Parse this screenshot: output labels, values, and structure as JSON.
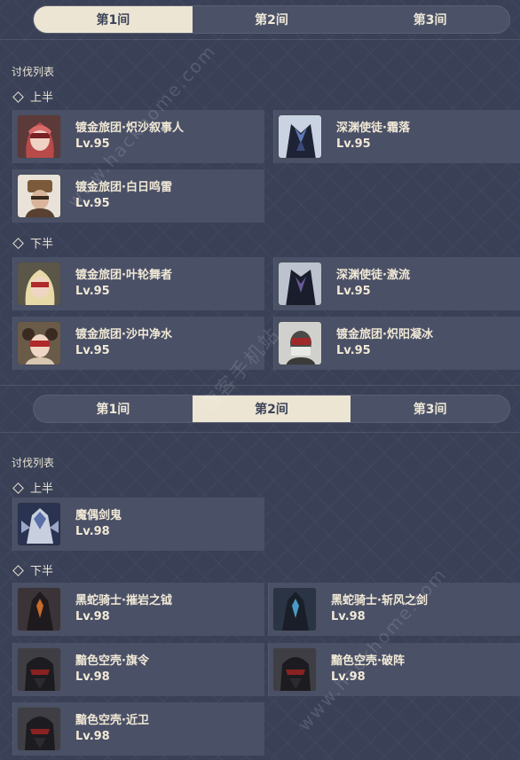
{
  "section1": {
    "tabs": [
      "第1间",
      "第2间",
      "第3间"
    ],
    "active_tab": 0,
    "list_title": "讨伐列表",
    "top_label": "上半",
    "bottom_label": "下半",
    "top": [
      {
        "name": "镀金旅团·炽沙叙事人",
        "level": "Lv.95",
        "avatar": "woman-red-hair-avatar"
      },
      {
        "name": "深渊使徒·霜落",
        "level": "Lv.95",
        "avatar": "abyss-herald-avatar"
      },
      {
        "name": "镀金旅团·白日鸣雷",
        "level": "Lv.95",
        "avatar": "man-turban-avatar"
      }
    ],
    "bottom": [
      {
        "name": "镀金旅团·叶轮舞者",
        "level": "Lv.95",
        "avatar": "blonde-masked-avatar"
      },
      {
        "name": "深渊使徒·激流",
        "level": "Lv.95",
        "avatar": "abyss-herald-avatar"
      },
      {
        "name": "镀金旅团·沙中净水",
        "level": "Lv.95",
        "avatar": "masked-dancer-avatar"
      },
      {
        "name": "镀金旅团·炽阳凝冰",
        "level": "Lv.95",
        "avatar": "masked-man-avatar"
      }
    ]
  },
  "section2": {
    "tabs": [
      "第1间",
      "第2间",
      "第3间"
    ],
    "active_tab": 1,
    "list_title": "讨伐列表",
    "top_label": "上半",
    "bottom_label": "下半",
    "top": [
      {
        "name": "魔偶剑鬼",
        "level": "Lv.98",
        "avatar": "maguu-kenki-avatar"
      }
    ],
    "bottom": [
      {
        "name": "黑蛇骑士·摧岩之钺",
        "level": "Lv.98",
        "avatar": "black-serpent-knight-avatar"
      },
      {
        "name": "黑蛇骑士·斩风之剑",
        "level": "Lv.98",
        "avatar": "black-serpent-knight-avatar"
      },
      {
        "name": "黯色空壳·旗令",
        "level": "Lv.98",
        "avatar": "shadowy-husk-avatar"
      },
      {
        "name": "黯色空壳·破阵",
        "level": "Lv.98",
        "avatar": "shadowy-husk-avatar"
      },
      {
        "name": "黯色空壳·近卫",
        "level": "Lv.98",
        "avatar": "shadowy-husk-avatar"
      }
    ]
  },
  "watermarks": [
    "www.hackhome.com",
    "嗨客手机站",
    "www.hackhome.com"
  ],
  "colors": {
    "background": "#3a4157",
    "card": "#4a5066",
    "tab_active": "#ece5d3",
    "text": "#f1e9d6"
  }
}
